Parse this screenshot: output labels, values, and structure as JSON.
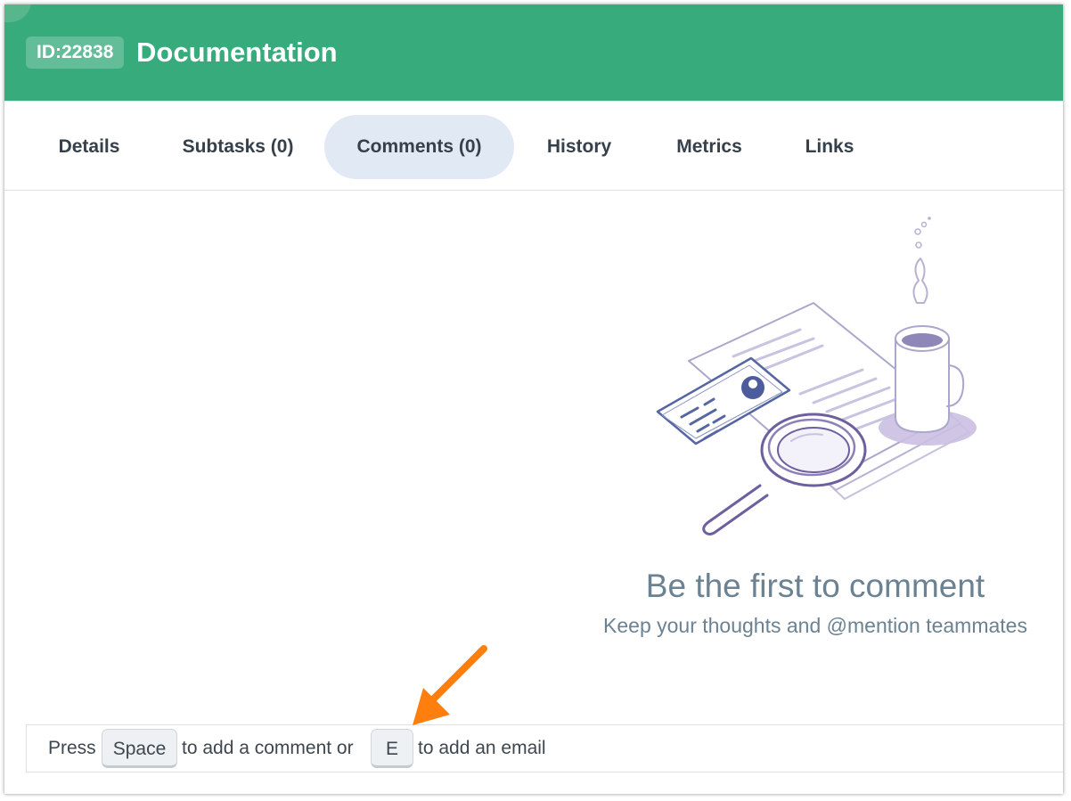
{
  "header": {
    "id_badge": "ID:22838",
    "title": "Documentation",
    "color": "#37ab7c"
  },
  "tabs": [
    {
      "label": "Details",
      "active": false
    },
    {
      "label": "Subtasks (0)",
      "active": false
    },
    {
      "label": "Comments (0)",
      "active": true
    },
    {
      "label": "History",
      "active": false
    },
    {
      "label": "Metrics",
      "active": false
    },
    {
      "label": "Links",
      "active": false
    }
  ],
  "empty_state": {
    "title": "Be the first to comment",
    "subtitle": "Keep your thoughts and @mention teammates",
    "illustration": "magnifier-coffee-documents-illustration"
  },
  "hint_bar": {
    "press": "Press",
    "space_key": "Space",
    "middle_text": "to add a comment or",
    "e_key": "E",
    "end_text": "to add an email"
  },
  "annotation": {
    "arrow_color": "#ff7f0e",
    "icon": "arrow-pointer-icon"
  }
}
